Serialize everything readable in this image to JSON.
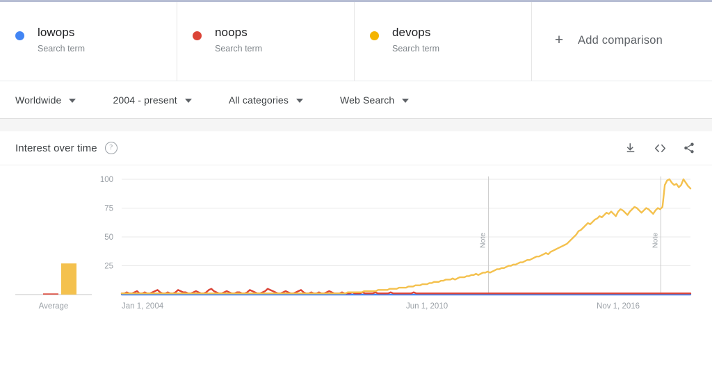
{
  "compare": {
    "terms": [
      {
        "name": "lowops",
        "type": "Search term",
        "color": "#4285F4"
      },
      {
        "name": "noops",
        "type": "Search term",
        "color": "#DB4437"
      },
      {
        "name": "devops",
        "type": "Search term",
        "color": "#F4B400"
      }
    ],
    "add_label": "Add comparison",
    "add_icon": "plus-icon"
  },
  "filters": [
    {
      "label": "Worldwide",
      "icon": "chevron-down-icon"
    },
    {
      "label": "2004 - present",
      "icon": "chevron-down-icon"
    },
    {
      "label": "All categories",
      "icon": "chevron-down-icon"
    },
    {
      "label": "Web Search",
      "icon": "chevron-down-icon"
    }
  ],
  "card": {
    "title": "Interest over time",
    "help_icon": "help-icon",
    "actions": [
      {
        "name": "download-icon"
      },
      {
        "name": "embed-icon"
      },
      {
        "name": "share-icon"
      }
    ]
  },
  "average": {
    "label": "Average",
    "values": [
      {
        "term": "lowops",
        "value": 0,
        "color": "#4285F4"
      },
      {
        "term": "noops",
        "value": 1,
        "color": "#DB4437"
      },
      {
        "term": "devops",
        "value": 27,
        "color": "#F4C14E"
      }
    ]
  },
  "chart_data": {
    "type": "line",
    "title": "Interest over time",
    "xlabel": "",
    "ylabel": "",
    "ylim": [
      0,
      100
    ],
    "yticks": [
      25,
      50,
      75,
      100
    ],
    "grid": true,
    "legend": "none",
    "xticks": [
      "Jan 1, 2004",
      "Jun 1, 2010",
      "Nov 1, 2016"
    ],
    "xtick_positions": [
      0,
      0.5,
      0.835
    ],
    "annotations": [
      {
        "label": "Note",
        "x": 0.645
      },
      {
        "label": "Note",
        "x": 0.948
      }
    ],
    "series": [
      {
        "name": "lowops",
        "color": "#4285F4",
        "values": [
          0,
          0,
          0,
          0,
          0,
          0,
          0,
          0,
          0,
          0,
          0,
          0,
          0,
          0,
          0,
          0,
          0,
          0,
          0,
          0,
          0,
          0,
          0,
          0,
          0,
          0,
          0,
          0,
          0,
          0,
          0,
          0,
          0,
          0,
          0,
          0,
          0,
          0,
          0,
          0,
          0,
          0,
          0,
          0,
          0,
          0,
          0,
          0,
          0,
          0,
          0,
          0,
          0,
          0,
          0,
          0,
          0,
          0,
          0,
          0,
          0,
          0,
          0,
          0,
          0,
          0,
          0,
          0,
          0,
          0,
          0,
          0,
          0,
          0,
          0,
          0,
          0,
          0,
          0,
          0,
          0,
          0,
          0,
          0,
          0,
          0,
          0,
          0,
          0,
          0,
          0,
          0,
          0,
          0,
          0,
          0,
          0,
          0,
          0,
          0,
          0,
          0,
          0,
          0,
          0,
          0,
          0,
          0,
          0,
          0,
          0,
          0,
          0,
          0,
          0,
          0,
          0,
          0,
          0,
          0,
          0,
          0,
          0,
          0,
          0,
          0,
          0,
          0,
          0,
          0,
          0,
          0,
          0,
          0,
          0,
          0,
          0,
          0,
          0,
          0,
          0,
          0,
          0,
          0,
          0,
          0,
          0,
          0,
          0,
          0,
          0,
          0,
          0,
          0,
          0,
          0,
          0,
          0,
          0,
          0,
          0,
          0,
          0,
          0,
          0,
          0,
          0,
          0,
          0,
          0,
          0,
          0,
          0,
          0,
          0,
          0,
          0,
          0,
          0,
          0,
          0,
          0,
          0,
          0,
          0,
          0,
          0,
          0,
          0,
          0,
          0,
          0,
          0,
          0,
          0,
          0,
          0,
          0,
          0,
          0,
          0,
          0,
          0,
          0,
          0,
          0,
          0,
          0,
          0,
          0,
          0,
          0,
          0,
          0,
          0,
          0,
          0,
          0
        ]
      },
      {
        "name": "noops",
        "color": "#DB4437",
        "values": [
          1,
          1,
          2,
          1,
          1,
          2,
          3,
          1,
          1,
          2,
          1,
          1,
          2,
          3,
          4,
          2,
          1,
          1,
          2,
          1,
          1,
          2,
          4,
          3,
          2,
          2,
          1,
          1,
          2,
          3,
          2,
          1,
          1,
          2,
          4,
          5,
          3,
          2,
          1,
          1,
          2,
          3,
          2,
          1,
          1,
          2,
          2,
          1,
          1,
          2,
          4,
          3,
          2,
          1,
          1,
          2,
          3,
          5,
          4,
          3,
          2,
          1,
          1,
          2,
          3,
          2,
          1,
          1,
          2,
          3,
          4,
          2,
          1,
          1,
          2,
          1,
          1,
          2,
          1,
          1,
          2,
          3,
          2,
          1,
          1,
          1,
          2,
          1,
          1,
          1,
          2,
          1,
          1,
          1,
          2,
          1,
          1,
          1,
          1,
          2,
          1,
          1,
          1,
          1,
          1,
          2,
          1,
          1,
          1,
          1,
          1,
          1,
          1,
          1,
          2,
          1,
          1,
          1,
          1,
          1,
          1,
          1,
          1,
          1,
          1,
          1,
          1,
          1,
          1,
          1,
          1,
          1,
          1,
          1,
          1,
          1,
          1,
          1,
          1,
          1,
          1,
          1,
          1,
          1,
          1,
          1,
          1,
          1,
          1,
          1,
          1,
          1,
          1,
          1,
          1,
          1,
          1,
          1,
          1,
          1,
          1,
          1,
          1,
          1,
          1,
          1,
          1,
          1,
          1,
          1,
          1,
          1,
          1,
          1,
          1,
          1,
          1,
          1,
          1,
          1,
          1,
          1,
          1,
          1,
          1,
          1,
          1,
          1,
          1,
          1,
          1,
          1,
          1,
          1,
          1,
          1,
          1,
          1,
          1,
          1,
          1,
          1,
          1,
          1,
          1,
          1,
          1,
          1,
          1,
          1,
          1,
          1,
          1,
          1,
          1,
          1,
          1,
          1,
          1,
          1,
          1,
          1,
          1
        ]
      },
      {
        "name": "devops",
        "color": "#F4C14E",
        "values": [
          1,
          1,
          1,
          1,
          1,
          1,
          1,
          1,
          1,
          1,
          1,
          1,
          1,
          1,
          1,
          1,
          1,
          1,
          1,
          1,
          1,
          1,
          1,
          1,
          1,
          1,
          1,
          1,
          1,
          1,
          1,
          1,
          1,
          1,
          1,
          1,
          1,
          1,
          1,
          1,
          1,
          1,
          1,
          1,
          1,
          1,
          1,
          1,
          1,
          1,
          1,
          1,
          1,
          1,
          1,
          1,
          1,
          1,
          1,
          1,
          1,
          1,
          1,
          1,
          1,
          1,
          1,
          1,
          1,
          1,
          1,
          1,
          1,
          1,
          1,
          1,
          1,
          1,
          1,
          1,
          1,
          1,
          1,
          1,
          1,
          1,
          1,
          1,
          1,
          1,
          1,
          1,
          1,
          1,
          1,
          1,
          1,
          2,
          2,
          2,
          2,
          2,
          2,
          2,
          3,
          3,
          3,
          3,
          3,
          3,
          4,
          4,
          4,
          4,
          4,
          5,
          5,
          5,
          5,
          6,
          6,
          6,
          6,
          7,
          7,
          7,
          8,
          8,
          8,
          9,
          9,
          9,
          10,
          10,
          11,
          11,
          11,
          12,
          12,
          13,
          13,
          13,
          14,
          13,
          14,
          15,
          15,
          15,
          16,
          16,
          17,
          17,
          18,
          17,
          18,
          19,
          19,
          20,
          19,
          20,
          21,
          22,
          22,
          23,
          23,
          24,
          25,
          25,
          26,
          26,
          27,
          28,
          28,
          29,
          30,
          30,
          31,
          32,
          33,
          33,
          34,
          35,
          36,
          35,
          37,
          38,
          39,
          40,
          41,
          42,
          43,
          44,
          46,
          48,
          50,
          52,
          55,
          56,
          58,
          60,
          62,
          61,
          63,
          65,
          66,
          68,
          67,
          69,
          71,
          70,
          72,
          70,
          68,
          72,
          74,
          73,
          71,
          69,
          72,
          74,
          76,
          75,
          73,
          71,
          73,
          75,
          74,
          72,
          70,
          73,
          75,
          74,
          76,
          95,
          99,
          100,
          97,
          95,
          96,
          93,
          95,
          100,
          97,
          94,
          92
        ]
      }
    ]
  }
}
